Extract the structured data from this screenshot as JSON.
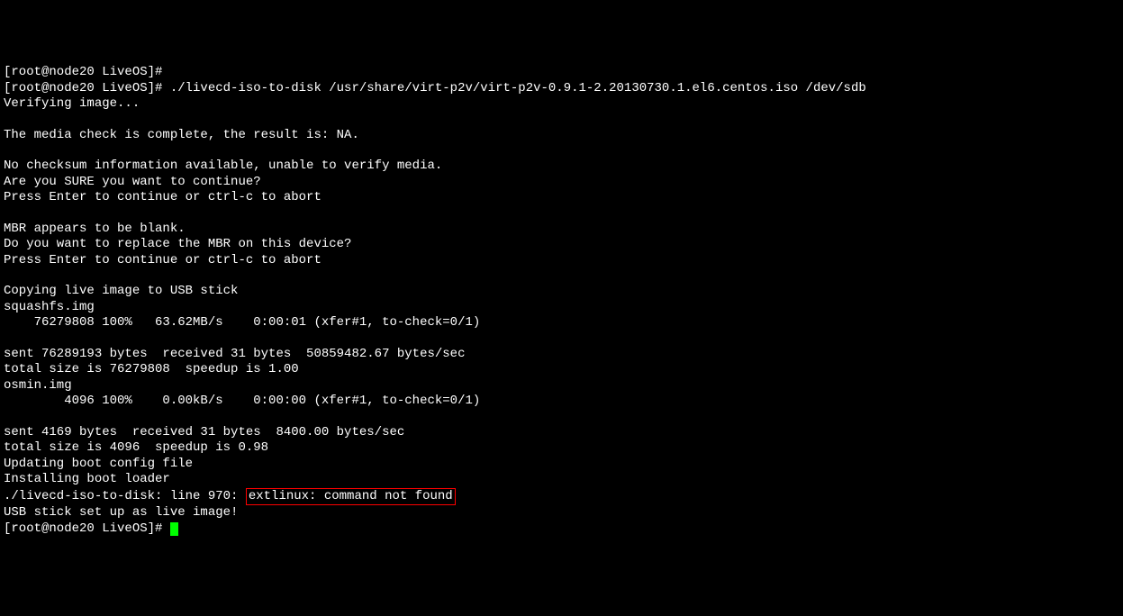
{
  "terminal": {
    "lines": [
      "[root@node20 LiveOS]#",
      "[root@node20 LiveOS]# ./livecd-iso-to-disk /usr/share/virt-p2v/virt-p2v-0.9.1-2.20130730.1.el6.centos.iso /dev/sdb",
      "Verifying image...",
      "",
      "The media check is complete, the result is: NA.",
      "",
      "No checksum information available, unable to verify media.",
      "Are you SURE you want to continue?",
      "Press Enter to continue or ctrl-c to abort",
      "",
      "MBR appears to be blank.",
      "Do you want to replace the MBR on this device?",
      "Press Enter to continue or ctrl-c to abort",
      "",
      "Copying live image to USB stick",
      "squashfs.img",
      "    76279808 100%   63.62MB/s    0:00:01 (xfer#1, to-check=0/1)",
      "",
      "sent 76289193 bytes  received 31 bytes  50859482.67 bytes/sec",
      "total size is 76279808  speedup is 1.00",
      "osmin.img",
      "        4096 100%    0.00kB/s    0:00:00 (xfer#1, to-check=0/1)",
      "",
      "sent 4169 bytes  received 31 bytes  8400.00 bytes/sec",
      "total size is 4096  speedup is 0.98",
      "Updating boot config file",
      "Installing boot loader"
    ],
    "error_line_prefix": "./livecd-iso-to-disk: line 970: ",
    "error_highlight": "extlinux: command not found",
    "after_error": "USB stick set up as live image!",
    "final_prompt": "[root@node20 LiveOS]# "
  }
}
